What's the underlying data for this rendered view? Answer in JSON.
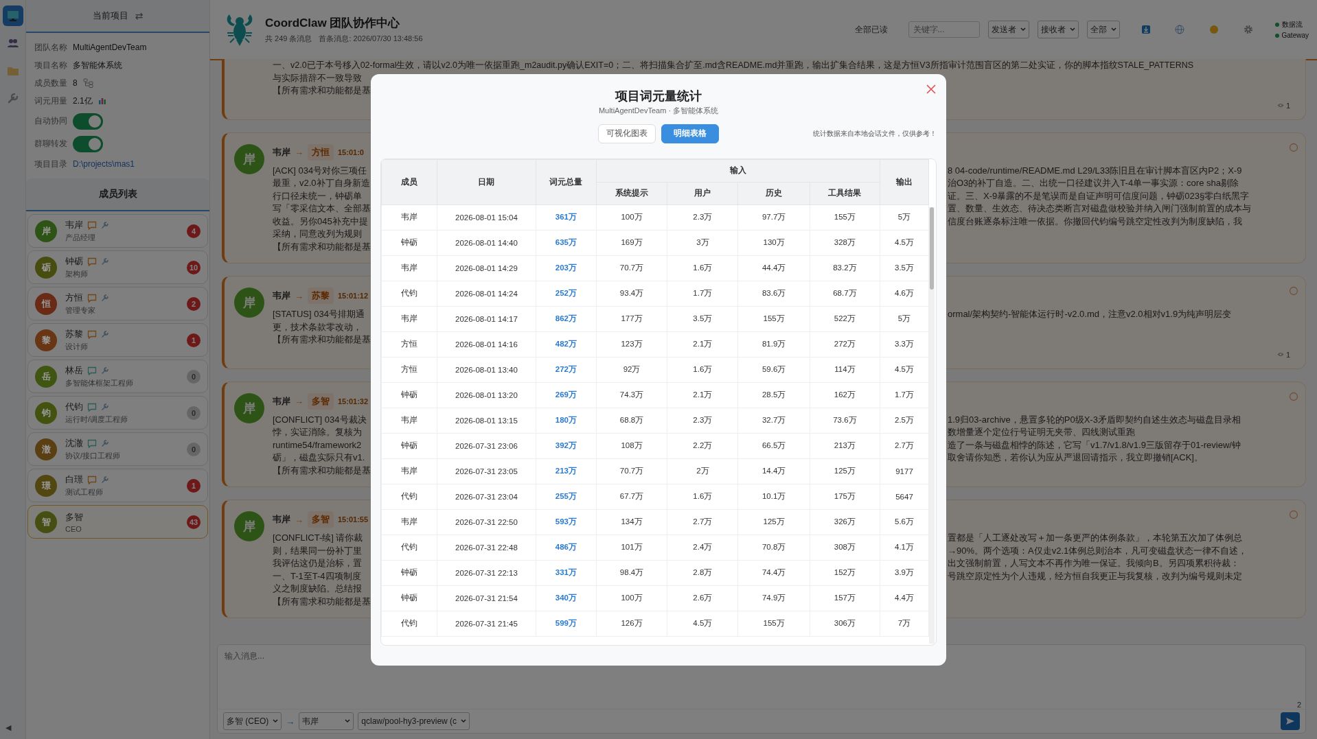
{
  "rail": [
    {
      "kind": "monitor",
      "selected": true
    },
    {
      "kind": "people",
      "selected": false
    },
    {
      "kind": "folder",
      "selected": false
    },
    {
      "kind": "wrench",
      "selected": false
    }
  ],
  "project": {
    "title": "当前项目",
    "switch_glyph": "⇄",
    "fields": [
      {
        "kind": "text",
        "label": "团队名称",
        "value": "MultiAgentDevTeam"
      },
      {
        "kind": "text",
        "label": "项目名称",
        "value": "多智能体系统"
      },
      {
        "kind": "members",
        "label": "成员数量",
        "value": "8"
      },
      {
        "kind": "usage",
        "label": "词元用量",
        "value": "2.1亿"
      },
      {
        "kind": "toggle",
        "label": "自动协同",
        "on": true
      },
      {
        "kind": "toggle",
        "label": "群聊转发",
        "on": true
      },
      {
        "kind": "link",
        "label": "项目目录",
        "value": "D:\\projects\\mas1"
      }
    ]
  },
  "members_title": "成员列表",
  "members": [
    {
      "kind": "agent",
      "avatar": "岸",
      "name": "韦岸",
      "role": "产品经理",
      "color": "#2d5416",
      "chat_active": true,
      "unread": "4",
      "selected": false
    },
    {
      "kind": "agent",
      "avatar": "砺",
      "name": "钟砺",
      "role": "架构师",
      "color": "#464d0e",
      "chat_active": true,
      "unread": "10",
      "selected": false
    },
    {
      "kind": "agent",
      "avatar": "恒",
      "name": "方恒",
      "role": "管理专家",
      "color": "#692a16",
      "chat_active": true,
      "unread": "2",
      "selected": false
    },
    {
      "kind": "agent",
      "avatar": "黎",
      "name": "苏黎",
      "role": "设计师",
      "color": "#683515",
      "chat_active": true,
      "unread": "1",
      "selected": false
    },
    {
      "kind": "agent",
      "avatar": "岳",
      "name": "林岳",
      "role": "多智能体框架工程师",
      "color": "#3f5511",
      "chat_active": false,
      "unread": "0",
      "selected": false
    },
    {
      "kind": "agent",
      "avatar": "钧",
      "name": "代钧",
      "role": "运行时/调度工程师",
      "color": "#445210",
      "chat_active": false,
      "unread": "0",
      "selected": false
    },
    {
      "kind": "agent",
      "avatar": "澈",
      "name": "沈澈",
      "role": "协议/接口工程师",
      "color": "#593f11",
      "chat_active": false,
      "unread": "0",
      "selected": false
    },
    {
      "kind": "agent",
      "avatar": "璟",
      "name": "白璟",
      "role": "测试工程师",
      "color": "#524611",
      "chat_active": true,
      "unread": "1",
      "selected": false
    },
    {
      "kind": "lead",
      "avatar": "智",
      "name": "多智",
      "role": "CEO",
      "color": "#464e11",
      "unread": "43",
      "selected": true
    }
  ],
  "collapse_glyph": "◀",
  "header": {
    "title": "CoordClaw 团队协作中心",
    "count": "共 249 条消息",
    "first": "首条消息: 2026/07/30 13:48:56"
  },
  "toolbar": {
    "mark_all": "全部已读",
    "search_placeholder": "关键字...",
    "filters": [
      "发送者",
      "接收者",
      "全部"
    ],
    "status": [
      {
        "label": "数据流",
        "on": true
      },
      {
        "label": "Gateway",
        "on": true
      }
    ]
  },
  "messages": [
    {
      "views": "1",
      "lines": [
        {
          "kind": "full",
          "text": "一、v2.0已于本号移入02-formal生效，请以v2.0为唯一依据重跑_m2audit.py确认EXIT=0；二、将扫描集合扩至.md含README.md并重跑，输出扩集合结果，这是方恒V3所指审计范围盲区的第二处实证，你的脚本指纹STALE_PATTERNS"
        },
        {
          "kind": "split",
          "left": "与实际措辞不一致导致"
        },
        {
          "kind": "split",
          "left": "【所有需求和功能都是基"
        }
      ]
    },
    {
      "avatar": "岸",
      "sender": "韦岸",
      "arrow": "→",
      "recipient": "方恒",
      "time": "15:01:0",
      "lines": [
        {
          "kind": "split",
          "left": "[ACK] 034号对你三项任",
          "right": "8 04-code/runtime/README.md L29/L33陈旧且在审计脚本盲区内P2；X-9"
        },
        {
          "kind": "split",
          "left": "最重，v2.0补丁自身新造",
          "right": "治O3的补丁自造。二、出统一口径建议并入T-4单一事实源：core sha剔除"
        },
        {
          "kind": "split",
          "left": "行口径未统一，钟砺单",
          "right": "证。三、X-9暴露的不是笔误而是自证声明可信度问题，钟砺023§零白纸黑字"
        },
        {
          "kind": "split",
          "left": "写「零采信文本、全部基",
          "right": "置、数量、生效态、待决态类断言对磁盘做校验并纳入闸门强制前置的成本与"
        },
        {
          "kind": "split",
          "left": "收益。另你045补充中提",
          "right": "信度台账逐条标注唯一依据。你撤回代钧编号跳空定性改判为制度缺陷，我"
        },
        {
          "kind": "split",
          "left": "采纳，同意改列为规则"
        },
        {
          "kind": "split",
          "left": "【所有需求和功能都是基"
        }
      ]
    },
    {
      "avatar": "岸",
      "sender": "韦岸",
      "arrow": "→",
      "recipient": "苏黎",
      "time": "15:01:12",
      "views": "1",
      "lines": [
        {
          "kind": "split",
          "left": "[STATUS] 034号排期通",
          "right": "ormal/架构契约-智能体运行时-v2.0.md，注意v2.0相对v1.9为纯声明层变"
        },
        {
          "kind": "split",
          "left": "更，技术条款零改动，"
        },
        {
          "kind": "split",
          "left": "【所有需求和功能都是基"
        }
      ]
    },
    {
      "avatar": "岸",
      "sender": "韦岸",
      "arrow": "→",
      "recipient": "多智",
      "time": "15:01:32",
      "lines": [
        {
          "kind": "split",
          "left": "[CONFLICT] 034号裁决",
          "right": "1.9归03-archive，悬置多轮的P0级X-3矛盾即契约自述生效态与磁盘目录相"
        },
        {
          "kind": "split",
          "left": "悖，实证消除。复核为",
          "right": "数增量逐个定位行号证明无夹带、四线测试重跑"
        },
        {
          "kind": "split",
          "left": "runtime54/framework2",
          "right": "造了一条与磁盘相悖的陈述，它写「v1.7/v1.8/v1.9三版留存于01-review/钟"
        },
        {
          "kind": "split",
          "left": "砺」，磁盘实际只有v1.",
          "right": "取舍请你知悉，若你认为应从严退回请指示，我立即撤销[ACK]。"
        },
        {
          "kind": "split",
          "left": "【所有需求和功能都是基"
        }
      ]
    },
    {
      "avatar": "岸",
      "sender": "韦岸",
      "arrow": "→",
      "recipient": "多智",
      "time": "15:01:55",
      "lines": [
        {
          "kind": "split",
          "left": "[CONFLICT-续] 请你裁",
          "right": "置都是「人工逐处改写＋加一条更严的体例条款」，本轮第五次加了体例总"
        },
        {
          "kind": "split",
          "left": "则，结果同一份补丁里",
          "right": "→90%。两个选项：A仅走v2.1体例总则治本，凡可变磁盘状态一律不自述，"
        },
        {
          "kind": "split",
          "left": "我评估这仍是治标，置",
          "right": "出文强制前置，人写文本不再作为唯一保证。我倾向B。另四项累积待裁："
        },
        {
          "kind": "split",
          "left": "一、T-1至T-4四项制度",
          "right": "号跳空原定性为个人违规，经方恒自我更正与我复核，改判为编号规则未定"
        },
        {
          "kind": "split",
          "left": "义之制度缺陷。总结报"
        },
        {
          "kind": "split",
          "left": "【所有需求和功能都是基"
        }
      ]
    }
  ],
  "composer": {
    "placeholder": "输入消息...",
    "counter": "2",
    "sender": "多智 (CEO)",
    "arrow": "→",
    "recipient": "韦岸",
    "model": "qclaw/pool-hy3-preview (c"
  },
  "modal": {
    "title": "项目词元量统计",
    "subtitle": "MultiAgentDevTeam · 多智能体系统",
    "tabs": [
      {
        "label": "可视化图表",
        "selected": false
      },
      {
        "label": "明细表格",
        "selected": true
      }
    ],
    "note": "统计数据来自本地会话文件，仅供参考！",
    "table": {
      "columns": [
        "成员",
        "日期",
        "词元总量"
      ],
      "group": "输入",
      "sub_columns": [
        "系统提示",
        "用户",
        "历史",
        "工具结果"
      ],
      "last_column": "输出",
      "rows": [
        [
          "韦岸",
          "2026-08-01 15:04",
          "361万",
          "100万",
          "2.3万",
          "97.7万",
          "155万",
          "5万"
        ],
        [
          "钟砺",
          "2026-08-01 14:40",
          "635万",
          "169万",
          "3万",
          "130万",
          "328万",
          "4.5万"
        ],
        [
          "韦岸",
          "2026-08-01 14:29",
          "203万",
          "70.7万",
          "1.6万",
          "44.4万",
          "83.2万",
          "3.5万"
        ],
        [
          "代钧",
          "2026-08-01 14:24",
          "252万",
          "93.4万",
          "1.7万",
          "83.6万",
          "68.7万",
          "4.6万"
        ],
        [
          "韦岸",
          "2026-08-01 14:17",
          "862万",
          "177万",
          "3.5万",
          "155万",
          "522万",
          "5万"
        ],
        [
          "方恒",
          "2026-08-01 14:16",
          "482万",
          "123万",
          "2.1万",
          "81.9万",
          "272万",
          "3.3万"
        ],
        [
          "方恒",
          "2026-08-01 13:40",
          "272万",
          "92万",
          "1.6万",
          "59.6万",
          "114万",
          "4.5万"
        ],
        [
          "钟砺",
          "2026-08-01 13:20",
          "269万",
          "74.3万",
          "2.1万",
          "28.5万",
          "162万",
          "1.7万"
        ],
        [
          "韦岸",
          "2026-08-01 13:15",
          "180万",
          "68.8万",
          "2.3万",
          "32.7万",
          "73.6万",
          "2.5万"
        ],
        [
          "钟砺",
          "2026-07-31 23:06",
          "392万",
          "108万",
          "2.2万",
          "66.5万",
          "213万",
          "2.7万"
        ],
        [
          "韦岸",
          "2026-07-31 23:05",
          "213万",
          "70.7万",
          "2万",
          "14.4万",
          "125万",
          "9177"
        ],
        [
          "代钧",
          "2026-07-31 23:04",
          "255万",
          "67.7万",
          "1.6万",
          "10.1万",
          "175万",
          "5647"
        ],
        [
          "韦岸",
          "2026-07-31 22:50",
          "593万",
          "134万",
          "2.7万",
          "125万",
          "326万",
          "5.6万"
        ],
        [
          "代钧",
          "2026-07-31 22:48",
          "486万",
          "101万",
          "2.4万",
          "70.8万",
          "308万",
          "4.1万"
        ],
        [
          "钟砺",
          "2026-07-31 22:13",
          "331万",
          "98.4万",
          "2.8万",
          "74.4万",
          "152万",
          "3.9万"
        ],
        [
          "钟砺",
          "2026-07-31 21:54",
          "340万",
          "100万",
          "2.6万",
          "74.9万",
          "157万",
          "4.4万"
        ],
        [
          "代钧",
          "2026-07-31 21:45",
          "599万",
          "126万",
          "4.5万",
          "155万",
          "306万",
          "7万"
        ]
      ]
    }
  }
}
